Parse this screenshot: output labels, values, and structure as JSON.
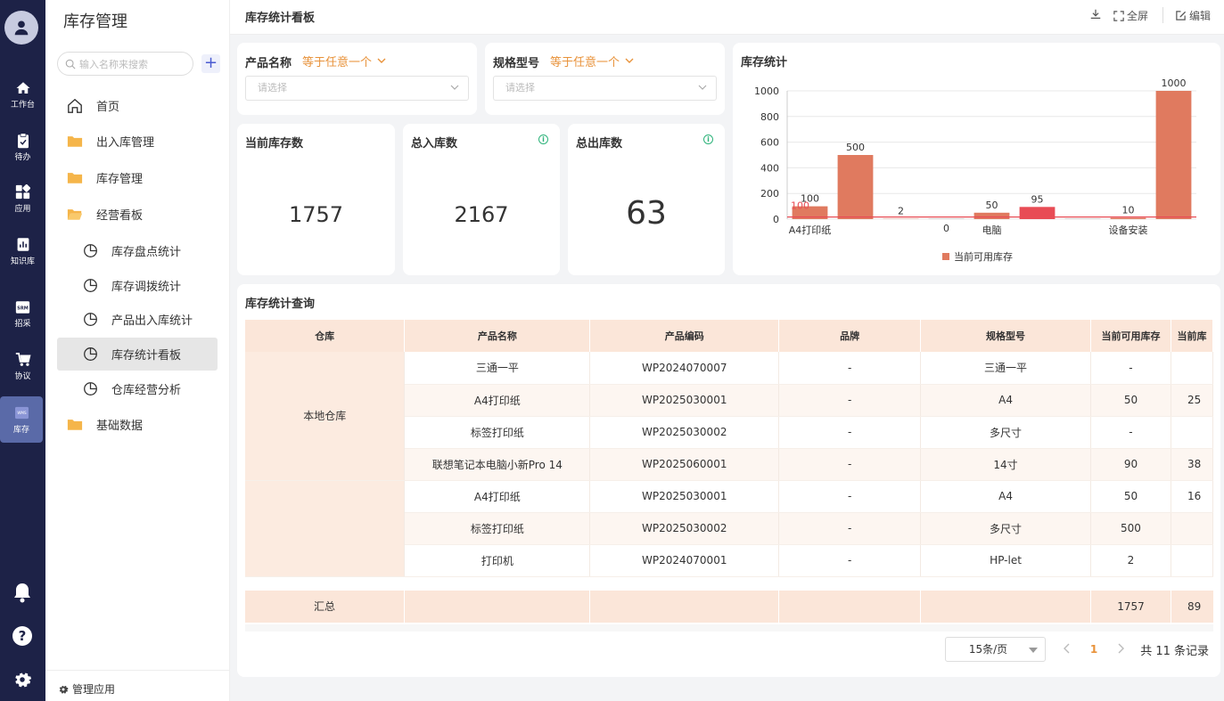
{
  "rail": {
    "items": [
      {
        "label": "工作台",
        "icon": "home-icon"
      },
      {
        "label": "待办",
        "icon": "clipboard-icon"
      },
      {
        "label": "应用",
        "icon": "apps-icon"
      },
      {
        "label": "知识库",
        "icon": "knowledge-icon"
      },
      {
        "label": "招采",
        "icon": "srm-icon"
      },
      {
        "label": "协议",
        "icon": "cart-icon"
      },
      {
        "label": "库存",
        "icon": "wms-icon"
      }
    ]
  },
  "sidebar": {
    "title": "库存管理",
    "search_placeholder": "输入名称来搜索",
    "items": [
      {
        "label": "首页"
      },
      {
        "label": "出入库管理"
      },
      {
        "label": "库存管理"
      },
      {
        "label": "经营看板"
      },
      {
        "label": "库存盘点统计"
      },
      {
        "label": "库存调拨统计"
      },
      {
        "label": "产品出入库统计"
      },
      {
        "label": "库存统计看板"
      },
      {
        "label": "仓库经营分析"
      },
      {
        "label": "基础数据"
      }
    ],
    "manage_label": "管理应用"
  },
  "topbar": {
    "title": "库存统计看板",
    "fullscreen_label": "全屏",
    "edit_label": "编辑"
  },
  "filters": {
    "product": {
      "label": "产品名称",
      "operator": "等于任意一个",
      "placeholder": "请选择"
    },
    "spec": {
      "label": "规格型号",
      "operator": "等于任意一个",
      "placeholder": "请选择"
    }
  },
  "stats": {
    "current": {
      "title": "当前库存数",
      "value": "1757"
    },
    "in": {
      "title": "总入库数",
      "value": "2167"
    },
    "out": {
      "title": "总出库数",
      "value": "63"
    }
  },
  "chart_data": {
    "type": "bar",
    "title": "库存统计",
    "x_tick_labels": [
      "A4打印纸",
      "电脑",
      "设备安装"
    ],
    "values": [
      100,
      500,
      2,
      0,
      50,
      95,
      0,
      10,
      1000
    ],
    "data_labels": [
      "100",
      "500",
      "2",
      "0",
      "50",
      "95",
      "",
      "10",
      "1000"
    ],
    "extra_label": "100",
    "series": [
      {
        "name": "当前可用库存",
        "values": [
          100,
          500,
          2,
          0,
          50,
          95,
          0,
          10,
          1000
        ]
      }
    ],
    "ylim": [
      0,
      1000
    ],
    "y_ticks": [
      0,
      200,
      400,
      600,
      800,
      1000
    ],
    "reference_line": 100,
    "legend_position": "bottom",
    "grid": true,
    "colors": {
      "bar": "#e07a5f",
      "highlight": "#e84c55",
      "ref_line": "#e84c55"
    }
  },
  "table": {
    "title": "库存统计查询",
    "columns": [
      "仓库",
      "产品名称",
      "产品编码",
      "品牌",
      "规格型号",
      "当前可用库存",
      "当前库"
    ],
    "groups": [
      {
        "warehouse": "本地仓库",
        "rows": [
          [
            "三通一平",
            "WP2024070007",
            "-",
            "三通一平",
            "-",
            ""
          ],
          [
            "A4打印纸",
            "WP2025030001",
            "-",
            "A4",
            "50",
            "25"
          ],
          [
            "标签打印纸",
            "WP2025030002",
            "-",
            "多尺寸",
            "-",
            ""
          ],
          [
            "联想笔记本电脑小新Pro 14",
            "WP2025060001",
            "-",
            "14寸",
            "90",
            "38"
          ]
        ]
      },
      {
        "warehouse": "",
        "rows": [
          [
            "A4打印纸",
            "WP2025030001",
            "-",
            "A4",
            "50",
            "16"
          ],
          [
            "标签打印纸",
            "WP2025030002",
            "-",
            "多尺寸",
            "500",
            ""
          ],
          [
            "打印机",
            "WP2024070001",
            "-",
            "HP-let",
            "2",
            ""
          ]
        ]
      }
    ],
    "summary": {
      "label": "汇总",
      "available": "1757",
      "current": "89"
    }
  },
  "pager": {
    "page_size": "15条/页",
    "current_page": "1",
    "total_text": "共 11 条记录"
  },
  "colors": {
    "rail": "#1d2247",
    "accent": "#e8923a",
    "header": "#fbe6d9"
  }
}
